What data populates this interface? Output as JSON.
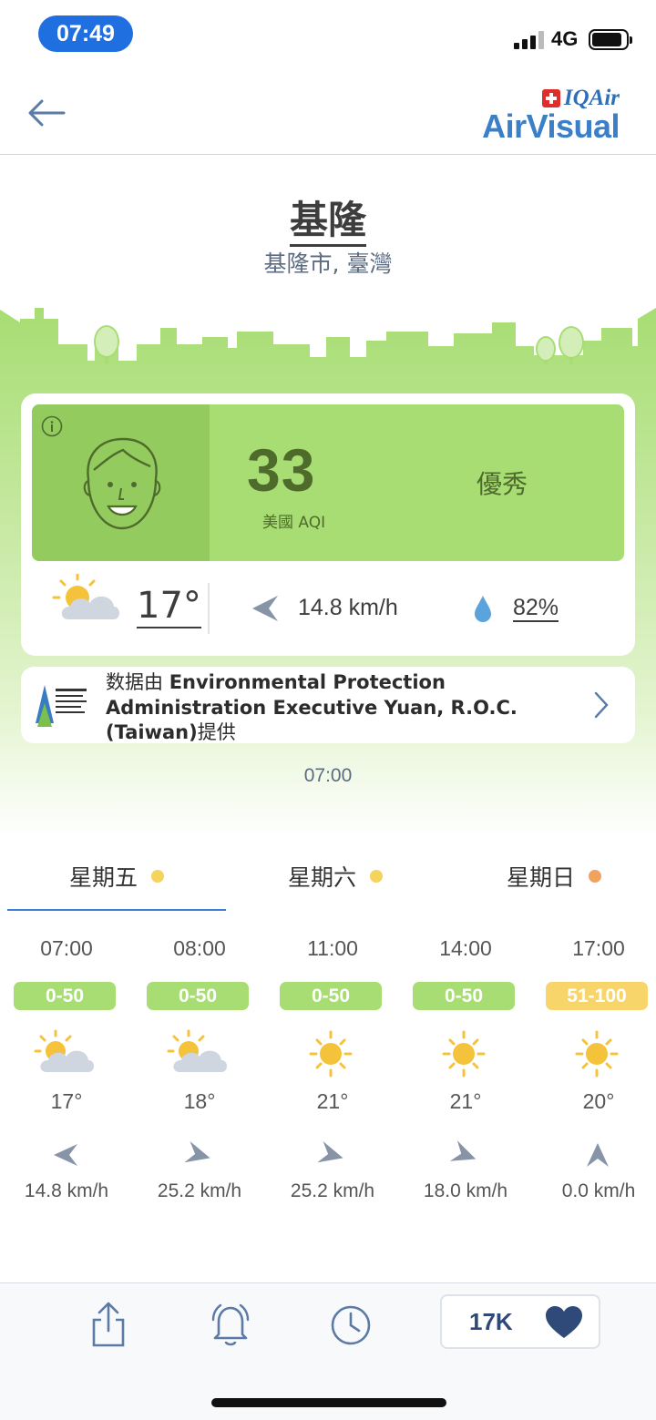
{
  "status_bar": {
    "time": "07:49",
    "network": "4G"
  },
  "header": {
    "logo_top": "IQAir",
    "logo_main": "AirVisual"
  },
  "location": {
    "city": "基隆",
    "region": "基隆市, 臺灣"
  },
  "aqi": {
    "value": "33",
    "label": "美國 AQI",
    "status": "優秀",
    "color": "#a7dd73"
  },
  "weather": {
    "temperature": "17°",
    "wind_speed": "14.8 km/h",
    "humidity": "82%"
  },
  "source": {
    "prefix": "数据由 ",
    "name": "Environmental Protection Administration Executive Yuan, R.O.C. (Taiwan)",
    "suffix": "提供"
  },
  "updated_time": "07:00",
  "days": [
    {
      "label": "星期五",
      "dot_color": "#f4d35e"
    },
    {
      "label": "星期六",
      "dot_color": "#f4d35e"
    },
    {
      "label": "星期日",
      "dot_color": "#f0a35e"
    }
  ],
  "hourly": [
    {
      "time": "07:00",
      "aqi_range": "0-50",
      "badge_color": "#a7dd73",
      "icon": "partly-cloudy-icon",
      "temp": "17°",
      "wind_icon": "wind-arrow-icon",
      "wind": "14.8 km/h"
    },
    {
      "time": "08:00",
      "aqi_range": "0-50",
      "badge_color": "#a7dd73",
      "icon": "partly-cloudy-icon",
      "temp": "18°",
      "wind_icon": "wind-arrow-icon",
      "wind": "25.2 km/h"
    },
    {
      "time": "11:00",
      "aqi_range": "0-50",
      "badge_color": "#a7dd73",
      "icon": "sun-icon",
      "temp": "21°",
      "wind_icon": "wind-arrow-icon",
      "wind": "25.2 km/h"
    },
    {
      "time": "14:00",
      "aqi_range": "0-50",
      "badge_color": "#a7dd73",
      "icon": "sun-icon",
      "temp": "21°",
      "wind_icon": "wind-arrow-icon",
      "wind": "18.0 km/h"
    },
    {
      "time": "17:00",
      "aqi_range": "51-100",
      "badge_color": "#f8d56a",
      "icon": "sun-icon",
      "temp": "20°",
      "wind_icon": "wind-arrow-icon",
      "wind": "0.0 km/h"
    }
  ],
  "bottom_bar": {
    "favorites_count": "17K"
  }
}
